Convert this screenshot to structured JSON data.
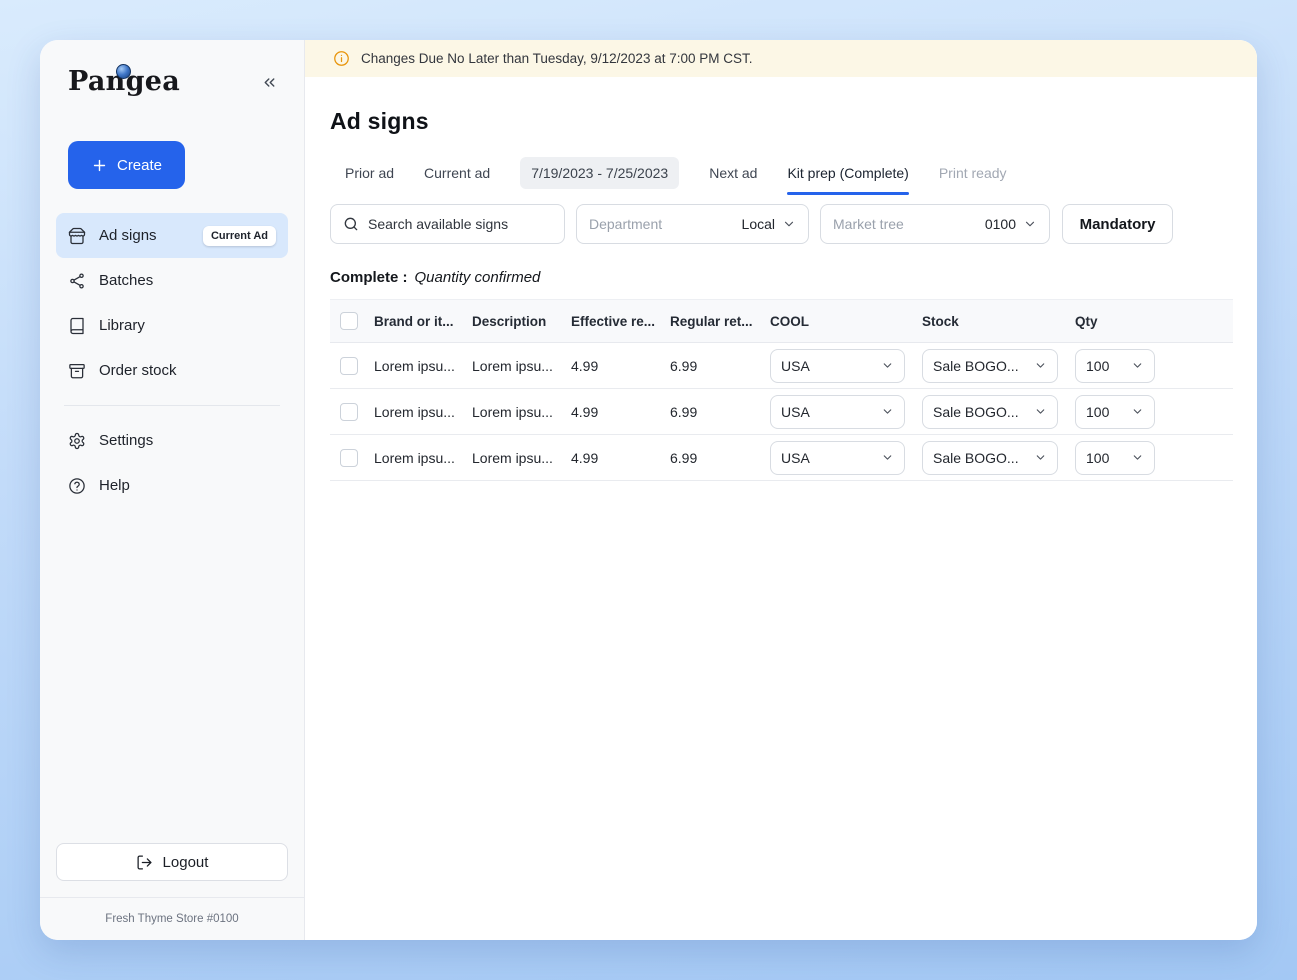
{
  "sidebar": {
    "logo": "Pangea",
    "create_label": "Create",
    "items": [
      {
        "label": "Ad signs",
        "icon": "storefront-icon",
        "badge": "Current Ad"
      },
      {
        "label": "Batches",
        "icon": "nodes-icon"
      },
      {
        "label": "Library",
        "icon": "book-icon"
      },
      {
        "label": "Order stock",
        "icon": "archive-icon"
      },
      {
        "label": "Settings",
        "icon": "gear-icon"
      },
      {
        "label": "Help",
        "icon": "question-circle-icon"
      }
    ],
    "logout_label": "Logout",
    "footer": "Fresh Thyme Store #0100"
  },
  "banner": {
    "text": "Changes Due No Later than Tuesday, 9/12/2023 at 7:00 PM CST.",
    "accent": "#E8950C"
  },
  "page": {
    "title": "Ad signs",
    "tabs": {
      "prior": "Prior ad",
      "current": "Current ad",
      "date_range": "7/19/2023 - 7/25/2023",
      "next": "Next ad",
      "kit_prep": "Kit prep (Complete)",
      "print_ready": "Print ready"
    },
    "filters": {
      "search_placeholder": "Search available signs",
      "department_label": "Department",
      "department_value": "Local",
      "market_tree_label": "Market tree",
      "market_tree_value": "0100",
      "mandatory_label": "Mandatory"
    },
    "status_label": "Complete :",
    "status_value": "Quantity confirmed",
    "table": {
      "headers": {
        "brand": "Brand or it...",
        "description": "Description",
        "effective": "Effective re...",
        "regular": "Regular ret...",
        "cool": "COOL",
        "stock": "Stock",
        "qty": "Qty"
      },
      "rows": [
        {
          "brand": "Lorem ipsu...",
          "description": "Lorem ipsu...",
          "effective": "4.99",
          "regular": "6.99",
          "cool": "USA",
          "stock": "Sale BOGO...",
          "qty": "100"
        },
        {
          "brand": "Lorem ipsu...",
          "description": "Lorem ipsu...",
          "effective": "4.99",
          "regular": "6.99",
          "cool": "USA",
          "stock": "Sale BOGO...",
          "qty": "100"
        },
        {
          "brand": "Lorem ipsu...",
          "description": "Lorem ipsu...",
          "effective": "4.99",
          "regular": "6.99",
          "cool": "USA",
          "stock": "Sale BOGO...",
          "qty": "100"
        }
      ]
    }
  },
  "colors": {
    "accent": "#2563EB",
    "active_nav_bg": "#D8E8FC",
    "banner_bg": "#FCF7E6"
  },
  "icons": {
    "collapse": "chevrons-left",
    "create": "plus",
    "banner": "info-circle",
    "search": "magnifier",
    "dropdown": "chevron-down",
    "logout": "exit-arrow"
  }
}
